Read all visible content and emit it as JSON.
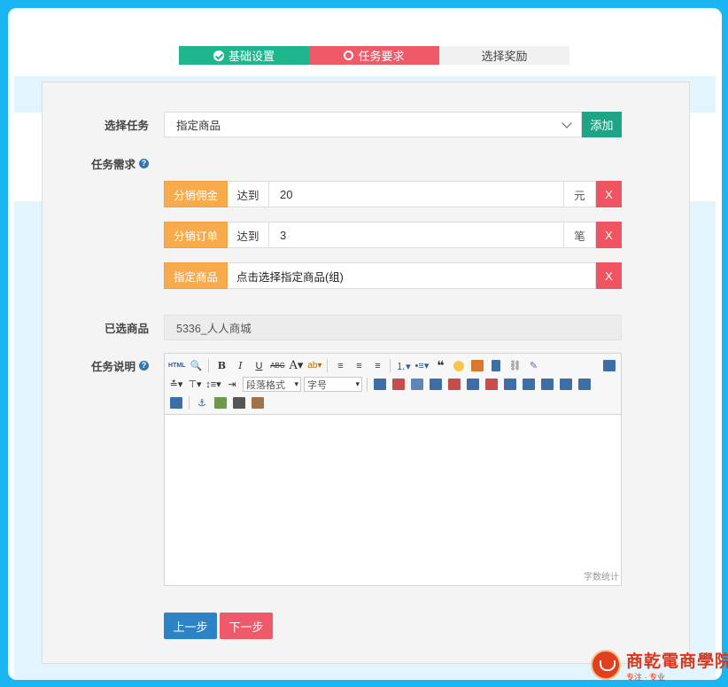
{
  "steps": [
    {
      "label": "基础设置",
      "state": "done"
    },
    {
      "label": "任务要求",
      "state": "active"
    },
    {
      "label": "选择奖励",
      "state": "pending"
    }
  ],
  "form": {
    "task_label": "选择任务",
    "task_selected": "指定商品",
    "add_button": "添加",
    "req_label": "任务需求",
    "requirements": [
      {
        "tag": "分销佣金",
        "op": "达到",
        "value": "20",
        "unit": "元",
        "remove": "X"
      },
      {
        "tag": "分销订单",
        "op": "达到",
        "value": "3",
        "unit": "笔",
        "remove": "X"
      },
      {
        "tag": "指定商品",
        "pick_text": "点击选择指定商品(组)",
        "remove": "X"
      }
    ],
    "selected_goods_label": "已选商品",
    "selected_goods_value": "5336_人人商城",
    "desc_label": "任务说明",
    "editor": {
      "html_btn": "HTML",
      "paragraph_format": "段落格式",
      "font_size": "字号",
      "word_count": "字数统计"
    },
    "prev_button": "上一步",
    "next_button": "下一步"
  },
  "watermark": {
    "title": "商乾電商學院",
    "subtitle": "专注 · 专业"
  },
  "colors": {
    "step_done": "#1fb68d",
    "step_active": "#ef5a68",
    "tag_orange": "#f8ab4d",
    "remove_red": "#ee5462",
    "primary_blue": "#2c84c6",
    "add_green": "#1fa585"
  }
}
